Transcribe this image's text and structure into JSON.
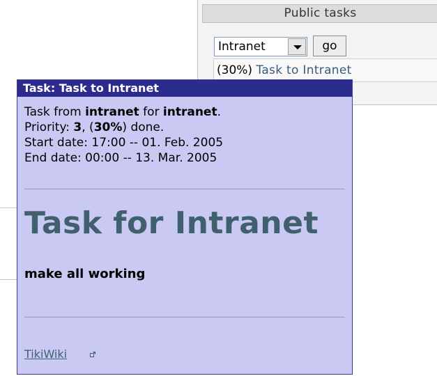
{
  "public_tasks": {
    "title": "Public tasks",
    "select_value": "Intranet",
    "go_label": "go",
    "task_percent": "(30%)",
    "task_link": "Task to Intranet"
  },
  "popup": {
    "header": "Task: Task to Intranet",
    "line1": {
      "pre": "Task from ",
      "from": "intranet",
      "mid": " for ",
      "for": "intranet",
      "post": "."
    },
    "line2": {
      "pre": "Priority: ",
      "priority": "3",
      "mid": ", (",
      "percent": "30%",
      "post": ") done."
    },
    "start_date": "Start date: 17:00 -- 01. Feb. 2005",
    "end_date": "End date: 00:00 -- 13. Mar. 2005",
    "big_title": "Task for Intranet",
    "description": "make all working",
    "footer_link": "TikiWiki"
  },
  "icons": {
    "external": "external-link-icon",
    "dropdown": "dropdown-arrow-icon"
  },
  "colors": {
    "popup_bg": "#c9c9f4",
    "popup_header": "#2c2c8f",
    "title_color": "#40606e"
  }
}
